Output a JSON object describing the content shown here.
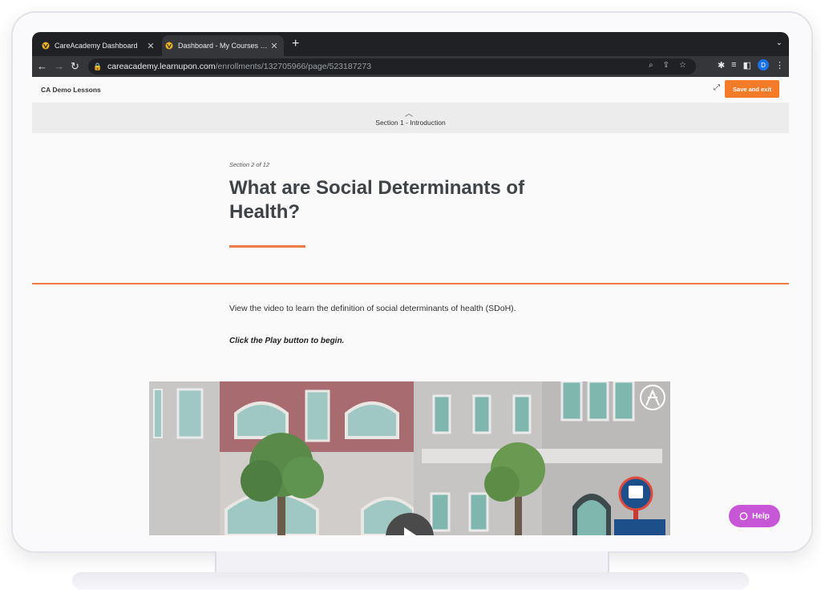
{
  "browser": {
    "tabs": [
      {
        "label": "CareAcademy Dashboard"
      },
      {
        "label": "Dashboard - My Courses - Sta"
      }
    ],
    "url_host": "careacademy.learnupon.com",
    "url_path": "/enrollments/132705966/page/523187273",
    "profile_initial": "D"
  },
  "app": {
    "course_title": "CA Demo Lessons",
    "save_label": "Save and exit",
    "section_nav_label": "Section 1 - Introduction"
  },
  "lesson": {
    "kicker": "Section 2 of 12",
    "title": "What are Social Determinants of Health?",
    "intro": "View the video to learn the definition of social determinants of health (SDoH).",
    "instruction": "Click the Play button to begin."
  },
  "help": {
    "label": "Help"
  },
  "colors": {
    "accent": "#ee7a45",
    "save_button": "#f47b2a",
    "help_button": "#c757d6"
  }
}
